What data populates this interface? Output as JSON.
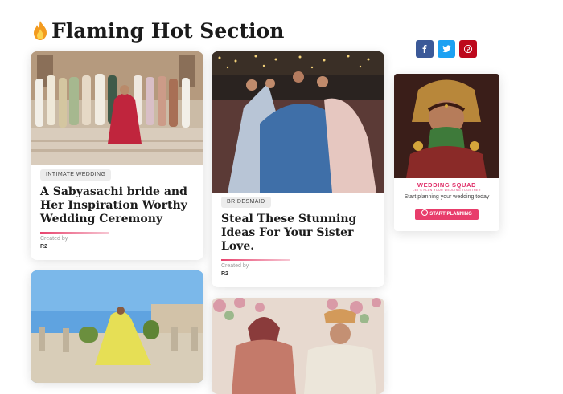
{
  "section": {
    "title": "Flaming Hot Section",
    "icon": "fire-icon"
  },
  "posts": [
    {
      "tag": "INTIMATE WEDDING",
      "title": "A Sabyasachi bride and Her Inspiration Worthy Wedding Ceremony",
      "created_label": "Created by",
      "author": "R2",
      "image": "group-wedding-photo"
    },
    {
      "tag": "BRIDESMAID",
      "title": "Steal These Stunning Ideas For Your Sister Love.",
      "created_label": "Created by",
      "author": "R2",
      "image": "bride-with-sisters-photo"
    },
    {
      "image": "bride-yellow-lehenga-photo"
    },
    {
      "image": "couple-wedding-photo"
    }
  ],
  "share": [
    {
      "network": "Facebook",
      "icon": "facebook-icon",
      "color": "#3b5998"
    },
    {
      "network": "Twitter",
      "icon": "twitter-icon",
      "color": "#1da1f2"
    },
    {
      "network": "Pinterest",
      "icon": "pinterest-icon",
      "color": "#bd081c"
    }
  ],
  "promo": {
    "brand": "WEDDING SQUAD",
    "brand_sub": "LET'S PLAN YOUR WEDDING TOGETHER",
    "text": "Start planning your wedding today",
    "button": "START PLANNING",
    "image": "bride-portrait-photo"
  },
  "colors": {
    "accent": "#e83d6b",
    "heading": "#1b1b1b",
    "tag_bg": "#ececec"
  }
}
